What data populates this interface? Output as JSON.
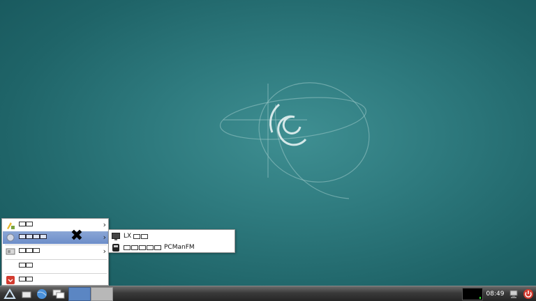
{
  "desktop": {
    "wallpaper": "debian-swirl"
  },
  "start_menu": {
    "items": [
      {
        "icon": "accessories-icon",
        "label_glyphs": 2,
        "has_submenu": true
      },
      {
        "icon": "system-tools-icon",
        "label_glyphs": 4,
        "has_submenu": true,
        "active": true
      },
      {
        "icon": "preferences-icon",
        "label_glyphs": 3,
        "has_submenu": true
      },
      {
        "icon": "run-icon",
        "label_glyphs": 2,
        "has_submenu": false
      },
      {
        "icon": "logout-icon",
        "label_glyphs": 2,
        "has_submenu": false
      }
    ]
  },
  "submenu": {
    "items": [
      {
        "icon": "terminal-icon",
        "prefix": "LX",
        "suffix": ""
      },
      {
        "icon": "file-manager-icon",
        "prefix": "",
        "suffix": "PCManFM"
      }
    ]
  },
  "taskbar": {
    "clock": "08:49",
    "buttons": [
      "start-menu-icon",
      "show-desktop-icon",
      "file-manager-icon",
      "browser-icon",
      "window-switcher-icon"
    ],
    "tray": [
      "cpu-monitor",
      "network-icon",
      "power-icon"
    ]
  },
  "colors": {
    "accent": "#6d8ec9",
    "power": "#d33b2f"
  }
}
